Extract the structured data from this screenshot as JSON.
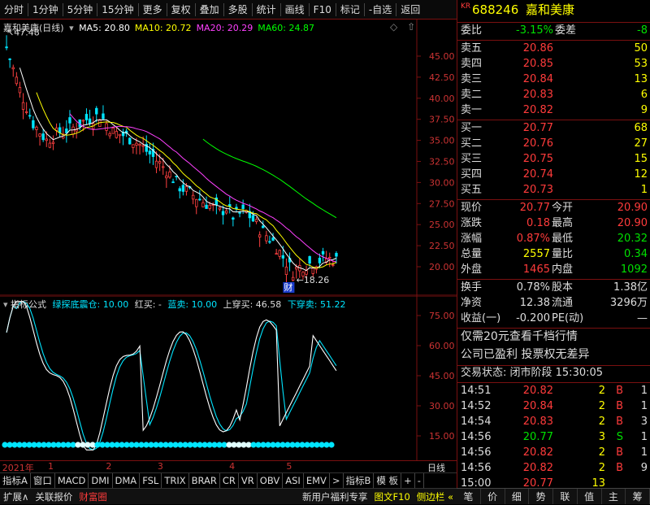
{
  "toolbar": {
    "items": [
      "分时",
      "1分钟",
      "5分钟",
      "15分钟",
      "更多",
      "复权",
      "叠加",
      "多股",
      "统计",
      "画线",
      "F10",
      "标记",
      "-自选",
      "返回"
    ]
  },
  "main_chart": {
    "title": "嘉和美康(日线)",
    "ma_labels": [
      {
        "text": "MA5: 20.80",
        "color": "#ffffff"
      },
      {
        "text": "MA10: 20.72",
        "color": "#ffff00"
      },
      {
        "text": "MA20: 20.29",
        "color": "#ff40ff"
      },
      {
        "text": "MA60: 24.87",
        "color": "#00ff00"
      }
    ],
    "high_label": "47.48",
    "low_label": "18.26",
    "marker_label": "财",
    "y_ticks": [
      "45.00",
      "42.50",
      "40.00",
      "37.50",
      "35.00",
      "32.50",
      "30.00",
      "27.50",
      "25.00",
      "22.50",
      "20.00"
    ]
  },
  "indicator": {
    "title": "指标公式",
    "name": "绿探底震仓: 10.00",
    "red_buy": "红买: -",
    "blue_sell": "蓝卖: 10.00",
    "cross_buy": "上穿买: 46.58",
    "cross_sell": "下穿卖: 51.22",
    "y_ticks": [
      "75.00",
      "60.00",
      "45.00",
      "30.00",
      "15.00"
    ]
  },
  "x_axis": {
    "labels": [
      {
        "text": "2021年",
        "pos": 0.005
      },
      {
        "text": "1",
        "pos": 0.105
      },
      {
        "text": "2",
        "pos": 0.232
      },
      {
        "text": "3",
        "pos": 0.345
      },
      {
        "text": "4",
        "pos": 0.502
      },
      {
        "text": "5",
        "pos": 0.627
      }
    ],
    "right_label": "日线"
  },
  "tabs": [
    "指标A",
    "窗口",
    "MACD",
    "DMI",
    "DMA",
    "FSL",
    "TRIX",
    "BRAR",
    "CR",
    "VR",
    "OBV",
    "ASI",
    "EMV",
    ">",
    "指标B",
    "模 板",
    "+",
    "-"
  ],
  "status_bar": {
    "left": [
      {
        "text": "扩展∧",
        "color": "#ddd"
      },
      {
        "text": "关联报价",
        "color": "#ddd"
      },
      {
        "text": "财富圈",
        "color": "#ff3b3b"
      }
    ],
    "right": [
      {
        "text": "新用户福利专享",
        "color": "#ddd"
      },
      {
        "text": "图文F10",
        "color": "#ffff00"
      },
      {
        "text": "侧边栏 «",
        "color": "#ffff00"
      }
    ]
  },
  "quote": {
    "prefix": "KR",
    "code": "688246",
    "name": "嘉和美康",
    "webi_label": "委比",
    "webi_value": "-3.15%",
    "weicha_label": "委差",
    "weicha_value": "-8",
    "asks": [
      {
        "label": "卖五",
        "price": "20.86",
        "vol": "50"
      },
      {
        "label": "卖四",
        "price": "20.85",
        "vol": "53"
      },
      {
        "label": "卖三",
        "price": "20.84",
        "vol": "13"
      },
      {
        "label": "卖二",
        "price": "20.83",
        "vol": "6"
      },
      {
        "label": "卖一",
        "price": "20.82",
        "vol": "9"
      }
    ],
    "bids": [
      {
        "label": "买一",
        "price": "20.77",
        "vol": "68"
      },
      {
        "label": "买二",
        "price": "20.76",
        "vol": "27"
      },
      {
        "label": "买三",
        "price": "20.75",
        "vol": "15"
      },
      {
        "label": "买四",
        "price": "20.74",
        "vol": "12"
      },
      {
        "label": "买五",
        "price": "20.73",
        "vol": "1"
      }
    ],
    "stats": [
      {
        "l1": "现价",
        "v1": "20.77",
        "c1": "#ff3b3b",
        "l2": "今开",
        "v2": "20.90",
        "c2": "#ff3b3b"
      },
      {
        "l1": "涨跌",
        "v1": "0.18",
        "c1": "#ff3b3b",
        "l2": "最高",
        "v2": "20.90",
        "c2": "#ff3b3b"
      },
      {
        "l1": "涨幅",
        "v1": "0.87%",
        "c1": "#ff3b3b",
        "l2": "最低",
        "v2": "20.32",
        "c2": "#00e000"
      },
      {
        "l1": "总量",
        "v1": "2557",
        "c1": "#ffff00",
        "l2": "量比",
        "v2": "0.34",
        "c2": "#00e000"
      },
      {
        "l1": "外盘",
        "v1": "1465",
        "c1": "#ff3b3b",
        "l2": "内盘",
        "v2": "1092",
        "c2": "#00e000"
      }
    ],
    "stats2": [
      {
        "l1": "换手",
        "v1": "0.78%",
        "l2": "股本",
        "v2": "1.38亿"
      },
      {
        "l1": "净资",
        "v1": "12.38",
        "l2": "流通",
        "v2": "3296万"
      },
      {
        "l1": "收益(一)",
        "v1": "-0.200",
        "l2": "PE(动)",
        "v2": "—"
      }
    ],
    "notice1": "仅需20元查看千档行情",
    "notice2": "公司已盈利 投票权无差异",
    "trade_state": "交易状态: 闭市阶段 15:30:05",
    "ticks": [
      {
        "time": "14:51",
        "price": "20.82",
        "vol": "2",
        "side": "B"
      },
      {
        "time": "14:52",
        "price": "20.84",
        "vol": "2",
        "side": "B"
      },
      {
        "time": "14:54",
        "price": "20.83",
        "vol": "2",
        "side": "B"
      },
      {
        "time": "14:56",
        "price": "20.77",
        "vol": "3",
        "side": "S"
      },
      {
        "time": "14:56",
        "price": "20.82",
        "vol": "2",
        "side": "B"
      },
      {
        "time": "14:56",
        "price": "20.82",
        "vol": "2",
        "side": "B"
      },
      {
        "time": "15:00",
        "price": "20.77",
        "vol": "13",
        "side": ""
      }
    ],
    "tick_counts": [
      "1",
      "1",
      "3",
      "1",
      "1",
      "9",
      ""
    ]
  },
  "bottom_nav": [
    "笔",
    "价",
    "细",
    "势",
    "联",
    "值",
    "主",
    "筹"
  ]
}
